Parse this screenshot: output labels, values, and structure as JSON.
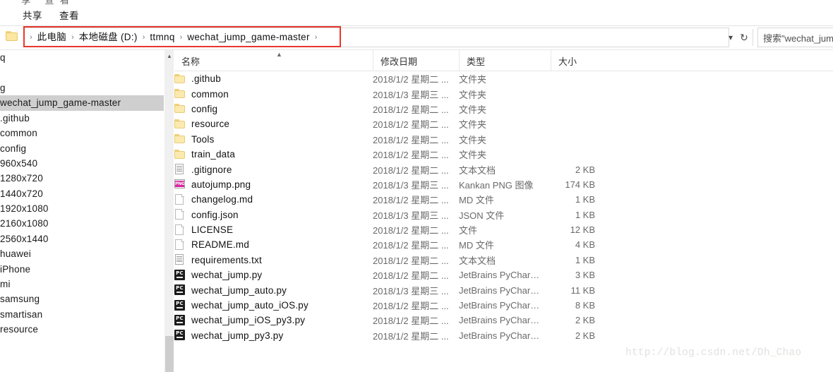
{
  "window": {
    "ribbon_ghost_text": "享   查看",
    "tabs": [
      {
        "label": "共享"
      },
      {
        "label": "查看"
      }
    ]
  },
  "address_bar": {
    "folder_icon": "folder-icon",
    "breadcrumbs": [
      {
        "label": "此电脑"
      },
      {
        "label": "本地磁盘 (D:)"
      },
      {
        "label": "ttmnq"
      },
      {
        "label": "wechat_jump_game-master"
      }
    ],
    "separator": "›",
    "dropdown_icon": "chevron-down-icon",
    "refresh_icon": "refresh-icon",
    "search_placeholder": "搜索\"wechat_jum",
    "annotation_color": "#e8372b"
  },
  "nav_pane": {
    "items": [
      {
        "label": "q",
        "selected": false
      },
      {
        "label": "",
        "selected": false
      },
      {
        "label": "g",
        "selected": false
      },
      {
        "label": "wechat_jump_game-master",
        "selected": true
      },
      {
        "label": ".github",
        "selected": false
      },
      {
        "label": "common",
        "selected": false
      },
      {
        "label": "config",
        "selected": false
      },
      {
        "label": "960x540",
        "selected": false
      },
      {
        "label": "1280x720",
        "selected": false
      },
      {
        "label": "1440x720",
        "selected": false
      },
      {
        "label": "1920x1080",
        "selected": false
      },
      {
        "label": "2160x1080",
        "selected": false
      },
      {
        "label": "2560x1440",
        "selected": false
      },
      {
        "label": "huawei",
        "selected": false
      },
      {
        "label": "iPhone",
        "selected": false
      },
      {
        "label": "mi",
        "selected": false
      },
      {
        "label": "samsung",
        "selected": false
      },
      {
        "label": "smartisan",
        "selected": false
      },
      {
        "label": "resource",
        "selected": false
      }
    ],
    "scroll_up_icon": "chevron-up-icon"
  },
  "columns": {
    "name": "名称",
    "date_modified": "修改日期",
    "type": "类型",
    "size": "大小",
    "sort_indicator": "sort-ascending-icon"
  },
  "files": [
    {
      "name": ".github",
      "date": "2018/1/2 星期二 ...",
      "type": "文件夹",
      "size": "",
      "icon": "folder"
    },
    {
      "name": "common",
      "date": "2018/1/3 星期三 ...",
      "type": "文件夹",
      "size": "",
      "icon": "folder"
    },
    {
      "name": "config",
      "date": "2018/1/2 星期二 ...",
      "type": "文件夹",
      "size": "",
      "icon": "folder"
    },
    {
      "name": "resource",
      "date": "2018/1/2 星期二 ...",
      "type": "文件夹",
      "size": "",
      "icon": "folder"
    },
    {
      "name": "Tools",
      "date": "2018/1/2 星期二 ...",
      "type": "文件夹",
      "size": "",
      "icon": "folder"
    },
    {
      "name": "train_data",
      "date": "2018/1/2 星期二 ...",
      "type": "文件夹",
      "size": "",
      "icon": "folder"
    },
    {
      "name": ".gitignore",
      "date": "2018/1/2 星期二 ...",
      "type": "文本文档",
      "size": "2 KB",
      "icon": "txt"
    },
    {
      "name": "autojump.png",
      "date": "2018/1/3 星期三 ...",
      "type": "Kankan PNG 图像",
      "size": "174 KB",
      "icon": "png"
    },
    {
      "name": "changelog.md",
      "date": "2018/1/2 星期二 ...",
      "type": "MD 文件",
      "size": "1 KB",
      "icon": "doc"
    },
    {
      "name": "config.json",
      "date": "2018/1/3 星期三 ...",
      "type": "JSON 文件",
      "size": "1 KB",
      "icon": "doc"
    },
    {
      "name": "LICENSE",
      "date": "2018/1/2 星期二 ...",
      "type": "文件",
      "size": "12 KB",
      "icon": "doc"
    },
    {
      "name": "README.md",
      "date": "2018/1/2 星期二 ...",
      "type": "MD 文件",
      "size": "4 KB",
      "icon": "doc"
    },
    {
      "name": "requirements.txt",
      "date": "2018/1/2 星期二 ...",
      "type": "文本文档",
      "size": "1 KB",
      "icon": "txt"
    },
    {
      "name": "wechat_jump.py",
      "date": "2018/1/2 星期二 ...",
      "type": "JetBrains PyChar…",
      "size": "3 KB",
      "icon": "py"
    },
    {
      "name": "wechat_jump_auto.py",
      "date": "2018/1/3 星期三 ...",
      "type": "JetBrains PyChar…",
      "size": "11 KB",
      "icon": "py"
    },
    {
      "name": "wechat_jump_auto_iOS.py",
      "date": "2018/1/2 星期二 ...",
      "type": "JetBrains PyChar…",
      "size": "8 KB",
      "icon": "py"
    },
    {
      "name": "wechat_jump_iOS_py3.py",
      "date": "2018/1/2 星期二 ...",
      "type": "JetBrains PyChar…",
      "size": "2 KB",
      "icon": "py"
    },
    {
      "name": "wechat_jump_py3.py",
      "date": "2018/1/2 星期二 ...",
      "type": "JetBrains PyChar…",
      "size": "2 KB",
      "icon": "py"
    }
  ],
  "watermark": {
    "text": "http://blog.csdn.net/Dh_Chao"
  }
}
